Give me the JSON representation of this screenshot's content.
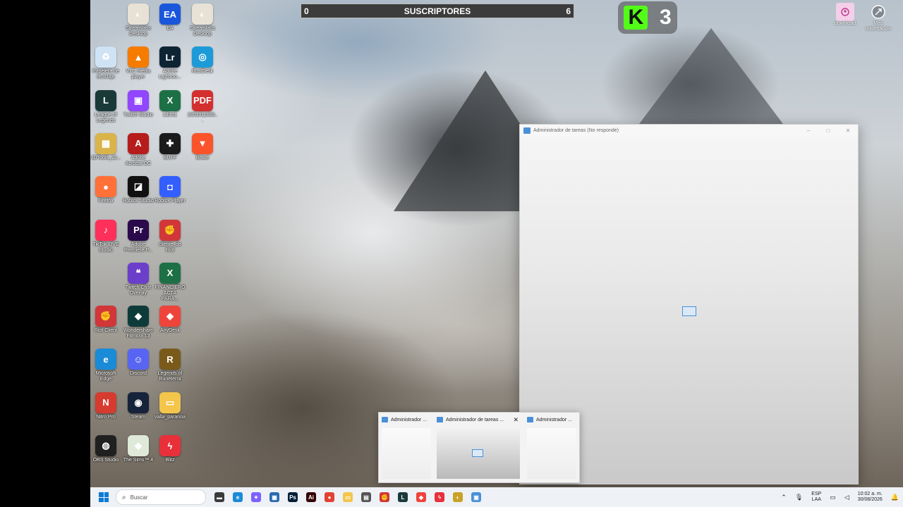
{
  "desktop_icons": [
    {
      "label": "Streamlabs Desktop",
      "color": "#e8e1d6",
      "glyph": "◐"
    },
    {
      "label": "EA",
      "color": "#1a56db",
      "glyph": "EA"
    },
    {
      "label": "Streamlabs Desktop",
      "color": "#e8e1d6",
      "glyph": "◐"
    },
    {
      "label": "Papelera de reciclaje",
      "color": "#cfe3f5",
      "glyph": "♻"
    },
    {
      "label": "VLC media player",
      "color": "#f57c00",
      "glyph": "▲"
    },
    {
      "label": "Adobe Lightroo...",
      "color": "#0d2434",
      "glyph": "Lr"
    },
    {
      "label": "RustDesk",
      "color": "#1d9bd8",
      "glyph": "◎"
    },
    {
      "label": "League of Legends",
      "color": "#1a3a3a",
      "glyph": "L"
    },
    {
      "label": "Twitch Studio",
      "color": "#9146ff",
      "glyph": "▣"
    },
    {
      "label": "Libro1",
      "color": "#1d7045",
      "glyph": "X"
    },
    {
      "label": "2801011668...",
      "color": "#d32f2f",
      "glyph": "PDF"
    },
    {
      "label": "3DTools_v2...",
      "color": "#d9b44a",
      "glyph": "▦"
    },
    {
      "label": "Adobe Acrobat DC",
      "color": "#b71c1c",
      "glyph": "A"
    },
    {
      "label": "BUFF",
      "color": "#1b1b1b",
      "glyph": "✚"
    },
    {
      "label": "Brave",
      "color": "#fb542b",
      "glyph": "▼"
    },
    {
      "label": "Firefox",
      "color": "#ff7139",
      "glyph": "●"
    },
    {
      "label": "Roblox Studio",
      "color": "#111111",
      "glyph": "◪"
    },
    {
      "label": "Roblox Player",
      "color": "#335fff",
      "glyph": "◘"
    },
    {
      "label": "TikTok LIVE Studio",
      "color": "#ff2f5b",
      "glyph": "♪"
    },
    {
      "label": "Adobe Premiere P...",
      "color": "#2a0a4a",
      "glyph": "Pr"
    },
    {
      "label": "cliente_de Riot",
      "color": "#d13639",
      "glyph": "✊"
    },
    {
      "label": "Twitch Chat Overlay",
      "color": "#6b3fc9",
      "glyph": "❝"
    },
    {
      "label": "FINANCIERO ACTA PARA...",
      "color": "#1d7045",
      "glyph": "X"
    },
    {
      "label": "Riot Client",
      "color": "#d13639",
      "glyph": "✊"
    },
    {
      "label": "Wondershare Filmora 13",
      "color": "#0d3b3a",
      "glyph": "◆"
    },
    {
      "label": "AnyDesk",
      "color": "#ef443b",
      "glyph": "◆"
    },
    {
      "label": "Microsoft Edge",
      "color": "#1a8bd6",
      "glyph": "e"
    },
    {
      "label": "Discord",
      "color": "#5865f2",
      "glyph": "☺"
    },
    {
      "label": "Legends of Runeterra",
      "color": "#7a5a1a",
      "glyph": "R"
    },
    {
      "label": "Nitro Pro",
      "color": "#d63b2f",
      "glyph": "N"
    },
    {
      "label": "Steam",
      "color": "#16233a",
      "glyph": "◉"
    },
    {
      "label": "valla_paranoa",
      "color": "#f3c64b",
      "glyph": "▭"
    },
    {
      "label": "OBS Studio",
      "color": "#202020",
      "glyph": "◍"
    },
    {
      "label": "The Sims™ 4",
      "color": "#dfe9da",
      "glyph": "◆"
    },
    {
      "label": "Blitz",
      "color": "#e8303a",
      "glyph": "ϟ"
    }
  ],
  "overlay": {
    "subs_left": "0",
    "subs_title": "SUSCRIPTORES",
    "subs_right": "6",
    "kick_letter": "K",
    "kick_count": "3"
  },
  "top_right": [
    {
      "label": "download"
    },
    {
      "label": "Más información"
    }
  ],
  "task_manager": {
    "title": "Administrador de tareas (No responde)"
  },
  "thumbnails": [
    {
      "label": "Administrador ..."
    },
    {
      "label": "Administrador de tareas ..."
    },
    {
      "label": "Administrador ..."
    }
  ],
  "taskbar": {
    "search_placeholder": "Buscar",
    "apps": [
      {
        "name": "file-explorer",
        "color": "#3a3a3a",
        "glyph": "▬"
      },
      {
        "name": "edge",
        "color": "#1a8bd6",
        "glyph": "e"
      },
      {
        "name": "copilot",
        "color": "#7b61ff",
        "glyph": "✦"
      },
      {
        "name": "store",
        "color": "#2b6cb0",
        "glyph": "▦"
      },
      {
        "name": "photoshop",
        "color": "#001e36",
        "glyph": "Ps"
      },
      {
        "name": "illustrator",
        "color": "#330000",
        "glyph": "Ai"
      },
      {
        "name": "chrome",
        "color": "#e34133",
        "glyph": "●"
      },
      {
        "name": "folder",
        "color": "#f3c64b",
        "glyph": "▭"
      },
      {
        "name": "app",
        "color": "#555555",
        "glyph": "▤"
      },
      {
        "name": "riot",
        "color": "#d13639",
        "glyph": "✊"
      },
      {
        "name": "league",
        "color": "#1a3a3a",
        "glyph": "L"
      },
      {
        "name": "anydesk",
        "color": "#ef443b",
        "glyph": "◆"
      },
      {
        "name": "blitz",
        "color": "#e8303a",
        "glyph": "ϟ"
      },
      {
        "name": "app2",
        "color": "#c9a227",
        "glyph": "◐"
      },
      {
        "name": "task-manager",
        "color": "#4a90d9",
        "glyph": "▣"
      }
    ],
    "lang_top": "ESP",
    "lang_bottom": "LAA",
    "time": "10:02 a. m.",
    "date": "30/08/2026"
  }
}
